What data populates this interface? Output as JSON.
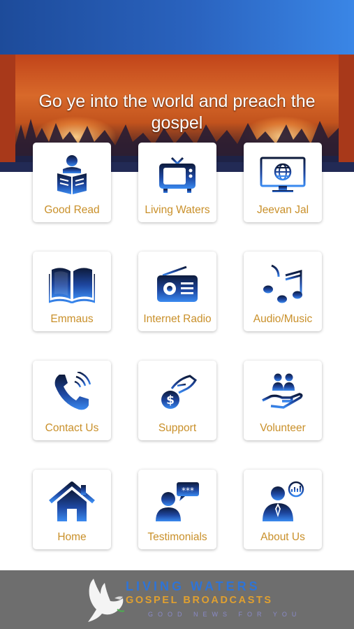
{
  "hero": {
    "title": "Go ye into the world and preach the gospel"
  },
  "tiles": [
    {
      "label": "Good Read",
      "icon": "reading-person-icon"
    },
    {
      "label": "Living Waters",
      "icon": "television-icon"
    },
    {
      "label": "Jeevan Jal",
      "icon": "globe-monitor-icon"
    },
    {
      "label": "Emmaus",
      "icon": "open-book-icon"
    },
    {
      "label": "Internet Radio",
      "icon": "radio-icon"
    },
    {
      "label": "Audio/Music",
      "icon": "music-notes-icon"
    },
    {
      "label": "Contact Us",
      "icon": "phone-icon"
    },
    {
      "label": "Support",
      "icon": "donation-hand-icon"
    },
    {
      "label": "Volunteer",
      "icon": "people-hand-icon"
    },
    {
      "label": "Home",
      "icon": "house-icon"
    },
    {
      "label": "Testimonials",
      "icon": "speech-person-icon"
    },
    {
      "label": "About Us",
      "icon": "speaker-person-icon"
    }
  ],
  "footer": {
    "line1": "LIVING WATERS",
    "line2": "GOSPEL BROADCASTS",
    "line3": "GOOD NEWS FOR YOU"
  },
  "colors": {
    "accent_blue": "#2a63bf",
    "label_gold": "#c9902a",
    "footer_gray": "#6e6e6e"
  }
}
